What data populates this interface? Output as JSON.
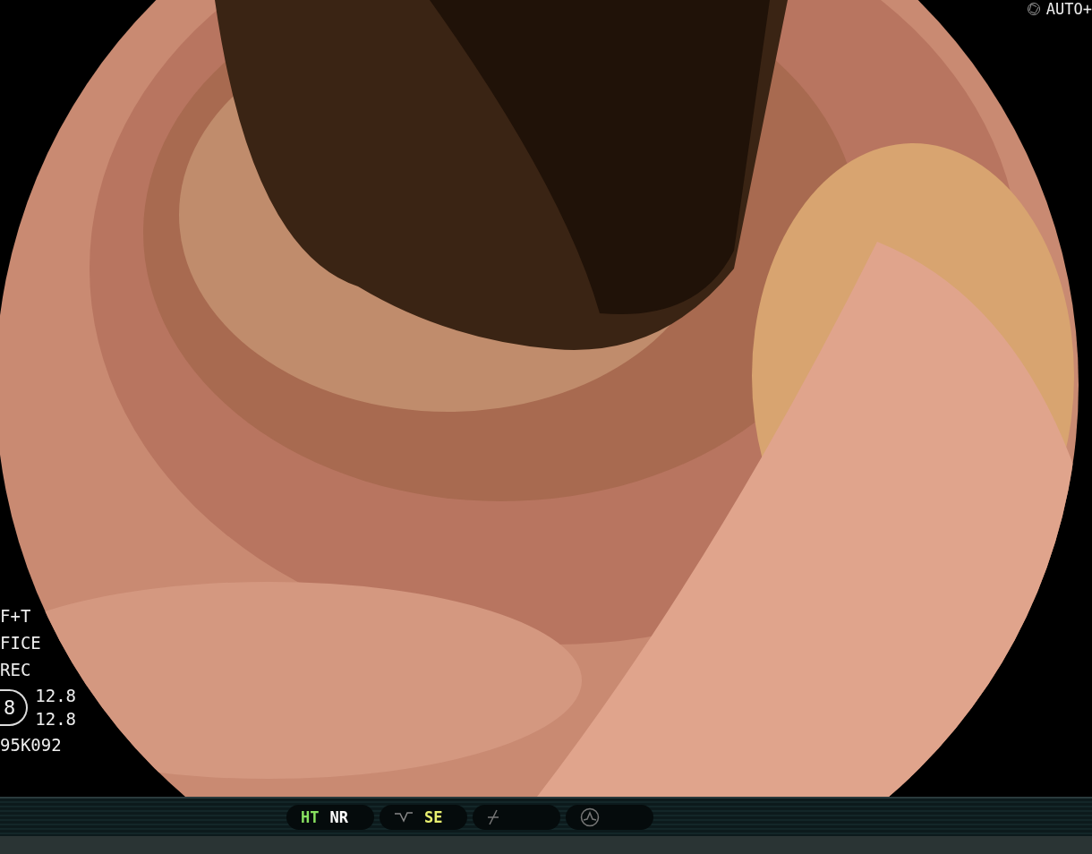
{
  "top_right": {
    "label": "AUTO+"
  },
  "left_info": {
    "lines": [
      "F+T",
      "FICE",
      "REC"
    ],
    "badge": "8",
    "readings": [
      "12.8",
      "12.8"
    ],
    "code": "95K092"
  },
  "status_groups": [
    {
      "kind": "text",
      "items": [
        {
          "label": "HT",
          "color": "#88e060"
        },
        {
          "label": "NR",
          "color": "#ffffff"
        }
      ]
    },
    {
      "kind": "curve",
      "items": [
        {
          "label": "SE",
          "color": "#e8f070"
        }
      ]
    },
    {
      "kind": "slash"
    },
    {
      "kind": "peak"
    }
  ]
}
